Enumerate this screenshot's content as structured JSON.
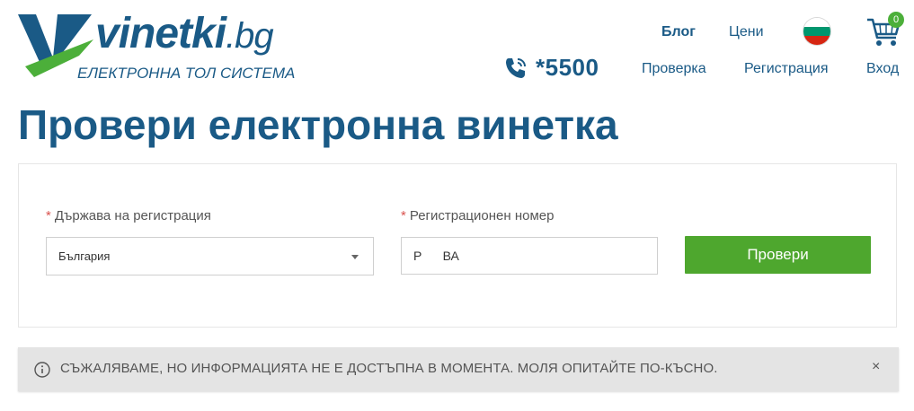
{
  "logo": {
    "word": "vinetki",
    "domain": ".bg",
    "tagline": "ЕЛЕКТРОННА ТОЛ СИСТЕМА",
    "brand_color": "#1a5a86",
    "accent_color": "#4caf3a"
  },
  "nav": {
    "blog": "Блог",
    "prices": "Цени",
    "check": "Проверка",
    "register": "Регистрация",
    "login": "Вход",
    "language_icon": "bulgarian-flag-icon",
    "cart_icon": "shopping-cart-icon",
    "cart_count": "0"
  },
  "phone": {
    "icon": "phone-icon",
    "number": "*5500"
  },
  "page": {
    "title": "Провери електронна винетка"
  },
  "form": {
    "country": {
      "required_mark": "*",
      "label": "Държава на регистрация",
      "value": "България"
    },
    "plate": {
      "required_mark": "*",
      "label": "Регистрационен номер",
      "value": "Р      ВА"
    },
    "submit_label": "Провери",
    "submit_color": "#4ea72e"
  },
  "alert": {
    "icon": "info-icon",
    "message": "СЪЖАЛЯВАМЕ, НО ИНФОРМАЦИЯТА НЕ Е ДОСТЪПНА В МОМЕНТА. МОЛЯ ОПИТАЙТЕ ПО-КЪСНО.",
    "close_label": "×"
  }
}
